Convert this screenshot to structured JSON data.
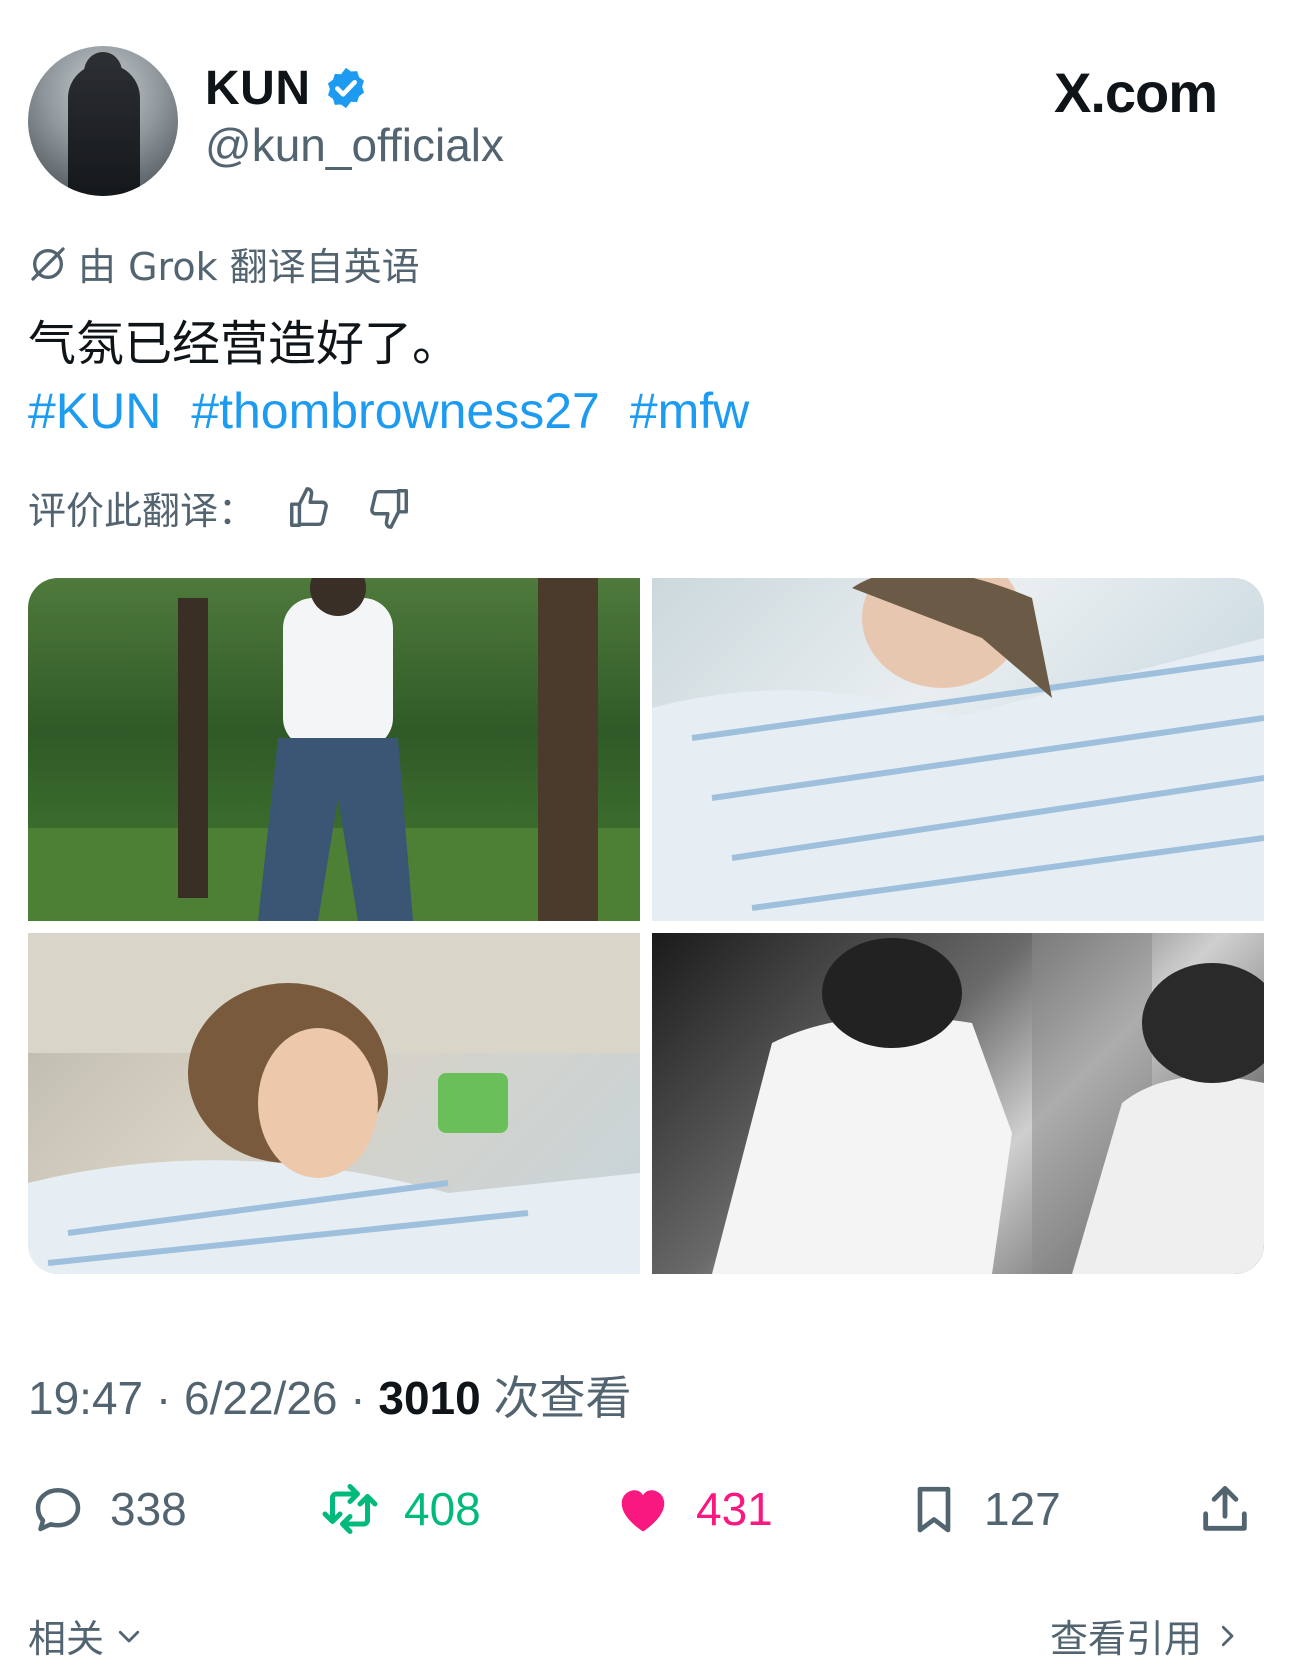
{
  "header": {
    "name": "KUN",
    "handle": "@kun_officialx",
    "site": "X.com"
  },
  "translation": {
    "note": "由 Grok 翻译自英语",
    "text": "气氛已经营造好了。",
    "hashtags": [
      "#KUN",
      "#thombrowness27",
      "#mfw"
    ],
    "rate_label": "评价此翻译："
  },
  "meta": {
    "time": "19:47",
    "sep1": " · ",
    "date": "6/22/26",
    "sep2": " · ",
    "views_count": "3010",
    "views_label": " 次查看"
  },
  "actions": {
    "replies": "338",
    "reposts": "408",
    "likes": "431",
    "bookmarks": "127"
  },
  "footer": {
    "related": "相关",
    "view_quotes": "查看引用"
  },
  "colors": {
    "accent": "#1d9bf0",
    "repost": "#00ba7c",
    "like": "#f91880",
    "muted": "#536471"
  }
}
